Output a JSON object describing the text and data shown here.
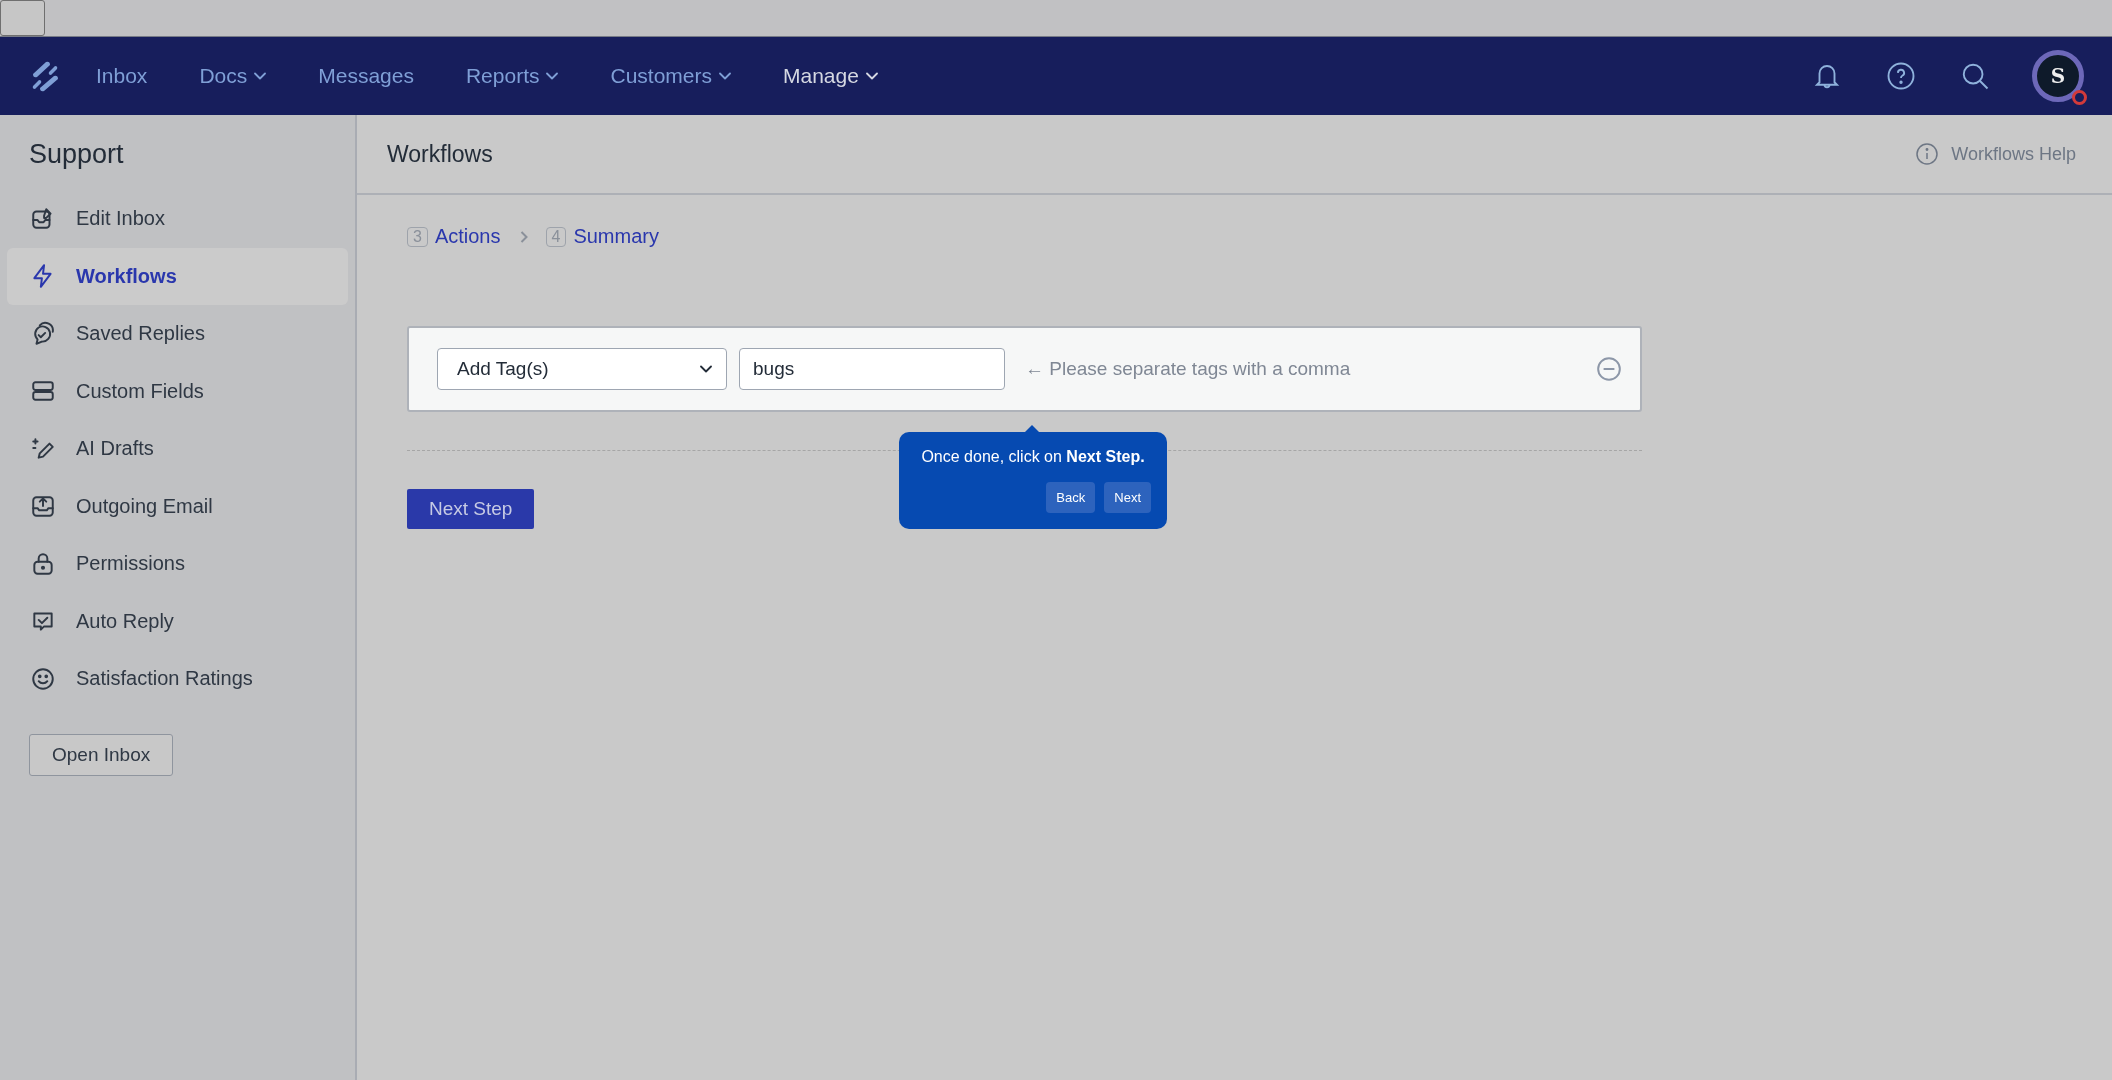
{
  "nav": {
    "items": [
      {
        "label": "Inbox",
        "dropdown": false,
        "selected": false
      },
      {
        "label": "Docs",
        "dropdown": true,
        "selected": false
      },
      {
        "label": "Messages",
        "dropdown": false,
        "selected": false
      },
      {
        "label": "Reports",
        "dropdown": true,
        "selected": false
      },
      {
        "label": "Customers",
        "dropdown": true,
        "selected": false
      },
      {
        "label": "Manage",
        "dropdown": true,
        "selected": true
      }
    ],
    "avatar": "S"
  },
  "sidebar": {
    "title": "Support",
    "items": [
      {
        "label": "Edit Inbox",
        "selected": false
      },
      {
        "label": "Workflows",
        "selected": true
      },
      {
        "label": "Saved Replies",
        "selected": false
      },
      {
        "label": "Custom Fields",
        "selected": false
      },
      {
        "label": "AI Drafts",
        "selected": false
      },
      {
        "label": "Outgoing Email",
        "selected": false
      },
      {
        "label": "Permissions",
        "selected": false
      },
      {
        "label": "Auto Reply",
        "selected": false
      },
      {
        "label": "Satisfaction Ratings",
        "selected": false
      }
    ],
    "button": "Open Inbox"
  },
  "header": {
    "title": "Workflows",
    "help": "Workflows Help"
  },
  "steps": [
    {
      "number": "3",
      "label": "Actions"
    },
    {
      "number": "4",
      "label": "Summary"
    }
  ],
  "action": {
    "select": "Add Tag(s)",
    "value": "bugs",
    "hint": "← Please separate tags with a comma"
  },
  "next_button": "Next Step",
  "tooltip": {
    "text": "Once done, click on **Next Step.**",
    "buttons": [
      "Back",
      "Next"
    ]
  }
}
